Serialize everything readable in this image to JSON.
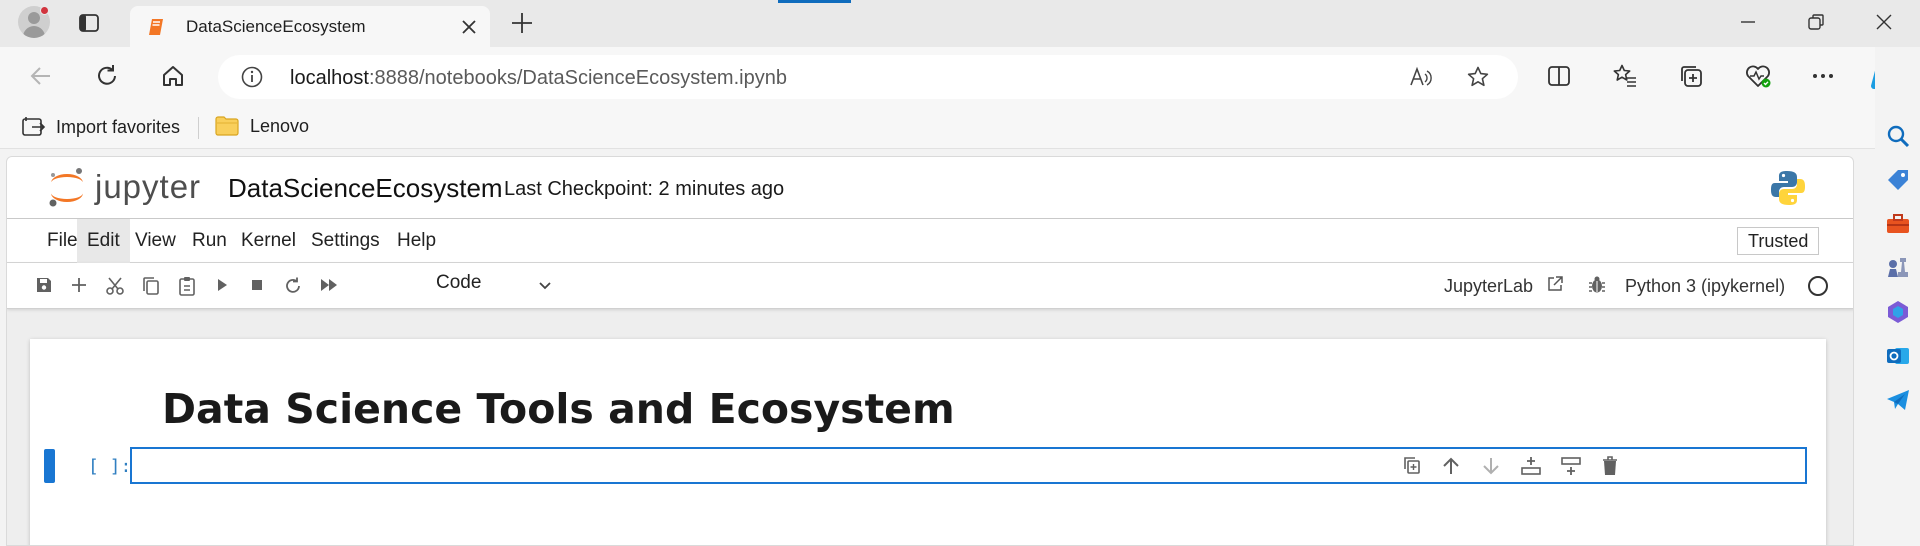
{
  "browser": {
    "tab": {
      "title": "DataScienceEcosystem"
    },
    "address": {
      "host": "localhost",
      "path": ":8888/notebooks/DataScienceEcosystem.ipynb"
    },
    "favorites": [
      {
        "label": "Import favorites",
        "icon": "import-favorites-icon"
      },
      {
        "label": "Lenovo",
        "icon": "folder-icon"
      }
    ],
    "sidebar_icons": [
      "search-icon",
      "shopping-tag-icon",
      "toolbox-icon",
      "games-icon",
      "copilot-m365-icon",
      "outlook-icon",
      "telegram-icon"
    ],
    "accent_color": "#0f6cbd"
  },
  "jupyter": {
    "wordmark": "jupyter",
    "notebook_title": "DataScienceEcosystem",
    "checkpoint": "Last Checkpoint: 2 minutes ago",
    "menu": [
      "File",
      "Edit",
      "View",
      "Run",
      "Kernel",
      "Settings",
      "Help"
    ],
    "active_menu": "Edit",
    "trusted": "Trusted",
    "toolbar": {
      "cell_type": "Code",
      "jupyterlab_label": "JupyterLab",
      "kernel_label": "Python 3 (ipykernel)"
    },
    "cells": {
      "markdown_heading": "Data Science Tools and Ecosystem",
      "code_prompt": "[ ]:",
      "code_value": ""
    },
    "accent_color": "#1976d2"
  }
}
